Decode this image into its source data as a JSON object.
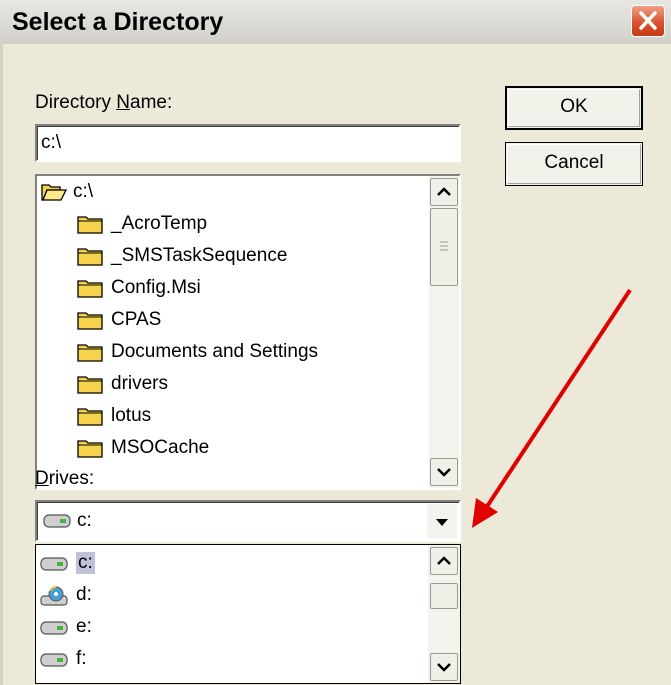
{
  "dialog": {
    "title": "Select a Directory",
    "dir_label_before": "Directory ",
    "dir_label_mnemonic": "N",
    "dir_label_after": "ame:",
    "dir_value": "c:\\",
    "ok_label": "OK",
    "cancel_label": "Cancel"
  },
  "tree": {
    "root": "c:\\",
    "folders": [
      "_AcroTemp",
      "_SMSTaskSequence",
      "Config.Msi",
      "CPAS",
      "Documents and Settings",
      "drivers",
      "lotus",
      "MSOCache"
    ]
  },
  "drives": {
    "label_mnemonic": "D",
    "label_after": "rives:",
    "selected": "c:",
    "list": [
      {
        "name": "c:",
        "icon": "hard-drive-icon"
      },
      {
        "name": "d:",
        "icon": "cd-drive-icon"
      },
      {
        "name": "e:",
        "icon": "hard-drive-icon"
      },
      {
        "name": "f:",
        "icon": "hard-drive-icon"
      }
    ]
  },
  "colors": {
    "annotation_arrow": "#e00000",
    "folder_yellow": "#f5d34c",
    "selection_highlight": "#c0c0d8",
    "close_button": "#d9532e"
  }
}
